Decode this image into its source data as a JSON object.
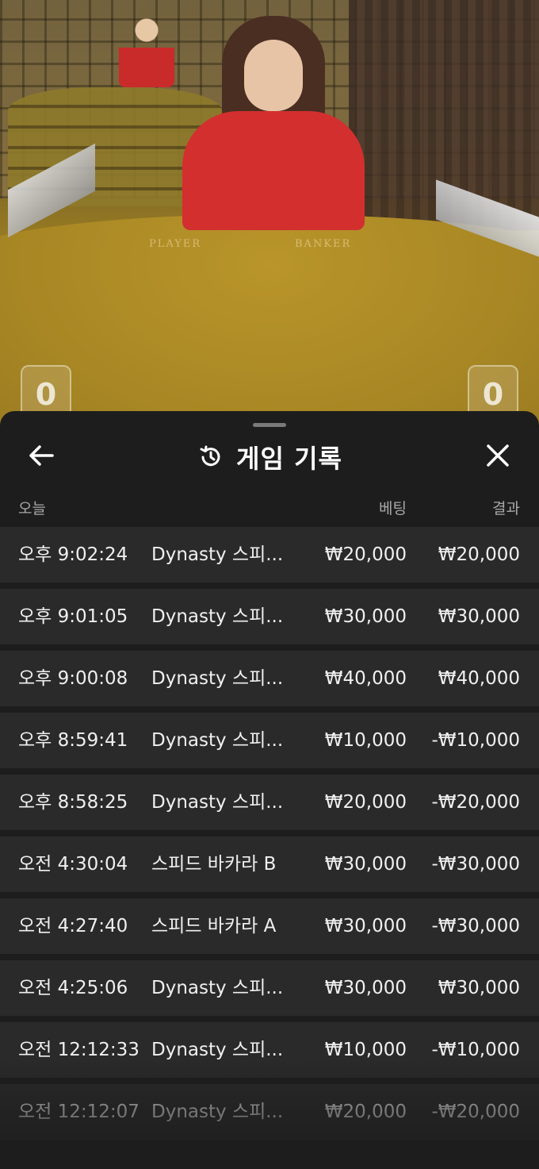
{
  "video": {
    "table_labels": [
      "PLAYER",
      "BANKER"
    ],
    "player_score": "0",
    "banker_score": "0"
  },
  "sheet": {
    "title": "게임 기록",
    "icons": {
      "back": "arrow-left-icon",
      "history": "history-clock-icon",
      "close": "close-icon"
    },
    "columns": {
      "date": "오늘",
      "bet": "베팅",
      "result": "결과"
    },
    "rows": [
      {
        "time": "오후 9:02:24",
        "game": "Dynasty 스피...",
        "bet": "₩20,000",
        "result": "₩20,000"
      },
      {
        "time": "오후 9:01:05",
        "game": "Dynasty 스피...",
        "bet": "₩30,000",
        "result": "₩30,000"
      },
      {
        "time": "오후 9:00:08",
        "game": "Dynasty 스피...",
        "bet": "₩40,000",
        "result": "₩40,000"
      },
      {
        "time": "오후 8:59:41",
        "game": "Dynasty 스피...",
        "bet": "₩10,000",
        "result": "-₩10,000"
      },
      {
        "time": "오후 8:58:25",
        "game": "Dynasty 스피...",
        "bet": "₩20,000",
        "result": "-₩20,000"
      },
      {
        "time": "오전 4:30:04",
        "game": "스피드 바카라 B",
        "bet": "₩30,000",
        "result": "-₩30,000"
      },
      {
        "time": "오전 4:27:40",
        "game": "스피드 바카라 A",
        "bet": "₩30,000",
        "result": "-₩30,000"
      },
      {
        "time": "오전 4:25:06",
        "game": "Dynasty 스피...",
        "bet": "₩30,000",
        "result": "₩30,000"
      },
      {
        "time": "오전 12:12:33",
        "game": "Dynasty 스피...",
        "bet": "₩10,000",
        "result": "-₩10,000"
      },
      {
        "time": "오전 12:12:07",
        "game": "Dynasty 스피...",
        "bet": "₩20,000",
        "result": "-₩20,000"
      }
    ]
  }
}
